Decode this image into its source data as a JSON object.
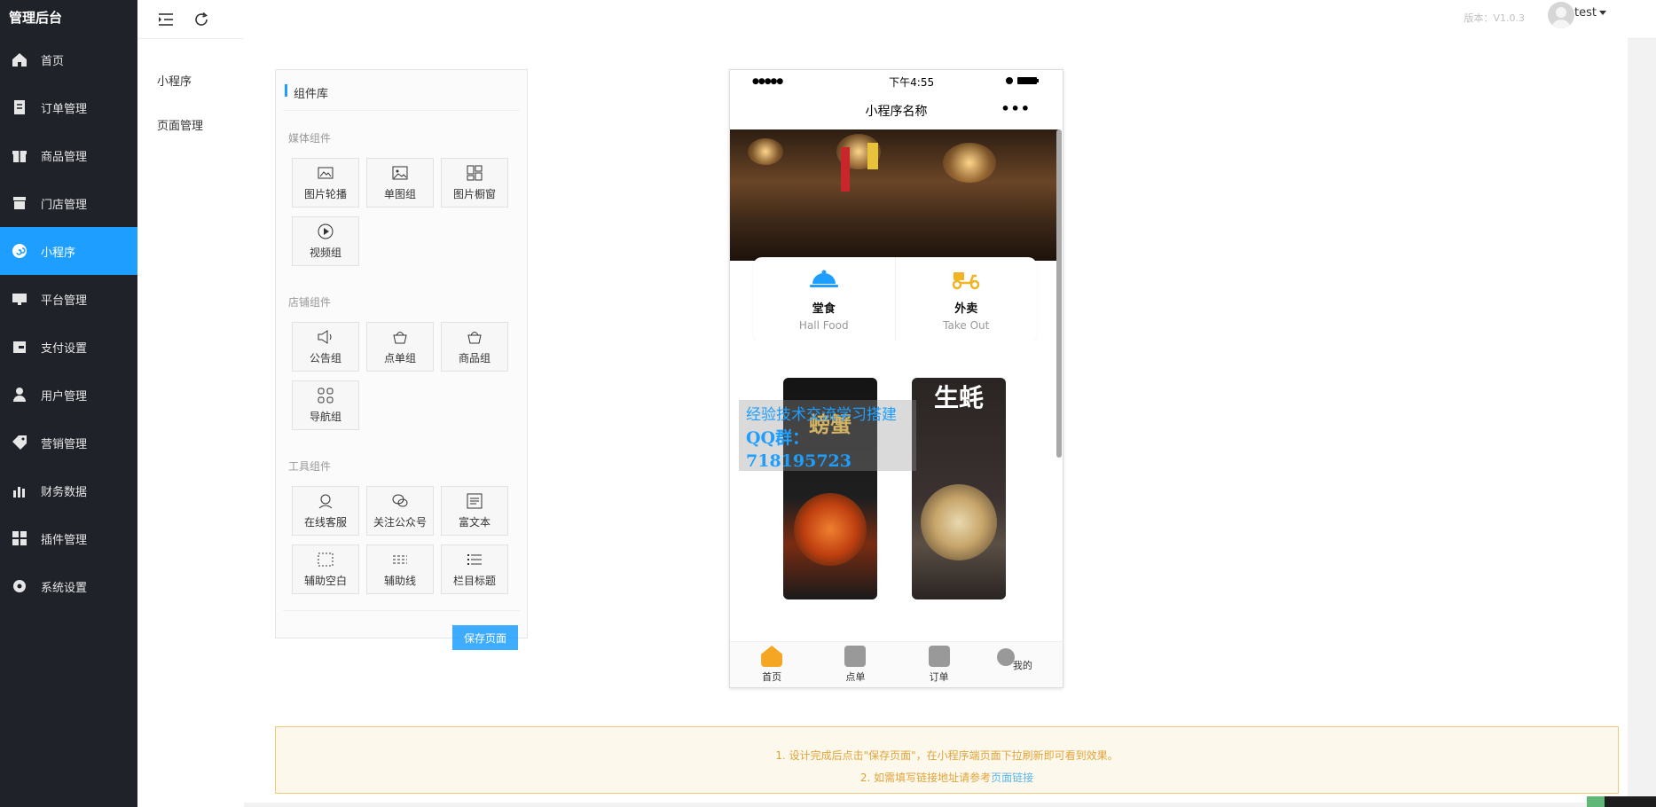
{
  "brand": "管理后台",
  "sidebar": {
    "items": [
      {
        "label": "首页",
        "icon": "home-icon"
      },
      {
        "label": "订单管理",
        "icon": "order-icon"
      },
      {
        "label": "商品管理",
        "icon": "gift-icon"
      },
      {
        "label": "门店管理",
        "icon": "store-icon"
      },
      {
        "label": "小程序",
        "icon": "miniapp-icon",
        "active": true
      },
      {
        "label": "平台管理",
        "icon": "monitor-icon"
      },
      {
        "label": "支付设置",
        "icon": "wallet-icon"
      },
      {
        "label": "用户管理",
        "icon": "user-icon"
      },
      {
        "label": "营销管理",
        "icon": "tag-icon"
      },
      {
        "label": "财务数据",
        "icon": "chart-icon"
      },
      {
        "label": "插件管理",
        "icon": "plugin-icon"
      },
      {
        "label": "系统设置",
        "icon": "gear-icon"
      }
    ]
  },
  "topbar": {
    "version": "版本：V1.0.3",
    "username": "test"
  },
  "subnav": {
    "items": [
      {
        "label": "小程序"
      },
      {
        "label": "页面管理"
      }
    ]
  },
  "library": {
    "title": "组件库",
    "groups": [
      {
        "name": "媒体组件",
        "items": [
          {
            "label": "图片轮播",
            "icon": "image-carousel-icon"
          },
          {
            "label": "单图组",
            "icon": "image-icon"
          },
          {
            "label": "图片橱窗",
            "icon": "grid-window-icon"
          },
          {
            "label": "视频组",
            "icon": "play-icon"
          }
        ]
      },
      {
        "name": "店铺组件",
        "items": [
          {
            "label": "公告组",
            "icon": "speaker-icon"
          },
          {
            "label": "点单组",
            "icon": "basket-icon"
          },
          {
            "label": "商品组",
            "icon": "basket-icon"
          },
          {
            "label": "导航组",
            "icon": "nav-grid-icon"
          }
        ]
      },
      {
        "name": "工具组件",
        "items": [
          {
            "label": "在线客服",
            "icon": "service-icon"
          },
          {
            "label": "关注公众号",
            "icon": "wechat-icon"
          },
          {
            "label": "富文本",
            "icon": "richtext-icon"
          },
          {
            "label": "辅助空白",
            "icon": "blank-icon"
          },
          {
            "label": "辅助线",
            "icon": "dashed-line-icon"
          },
          {
            "label": "栏目标题",
            "icon": "list-title-icon"
          }
        ]
      }
    ],
    "save_label": "保存页面"
  },
  "phone": {
    "status_time": "下午4:55",
    "status_dots": "●●●●●",
    "title": "小程序名称",
    "more": "•••",
    "cards": [
      {
        "title": "堂食",
        "subtitle": "Hall Food",
        "icon": "cloche-icon"
      },
      {
        "title": "外卖",
        "subtitle": "Take Out",
        "icon": "scooter-icon"
      }
    ],
    "posters": [
      {
        "text": "螃蟹"
      },
      {
        "text": "生蚝"
      }
    ],
    "watermark": {
      "line1": "经验技术交流学习搭建",
      "line2": "QQ群：718195723"
    },
    "tabs": [
      {
        "label": "首页",
        "active": true
      },
      {
        "label": "点单"
      },
      {
        "label": "订单"
      },
      {
        "label": "我的"
      }
    ]
  },
  "notice": {
    "line1": "1. 设计完成后点击\"保存页面\"，在小程序端页面下拉刷新即可看到效果。",
    "line2_prefix": "2. 如需填写链接地址请参考",
    "line2_link": "页面链接"
  },
  "colors": {
    "sidebar_bg": "#20222a",
    "accent": "#1E9FFF",
    "notice_border": "#f0c87a"
  }
}
